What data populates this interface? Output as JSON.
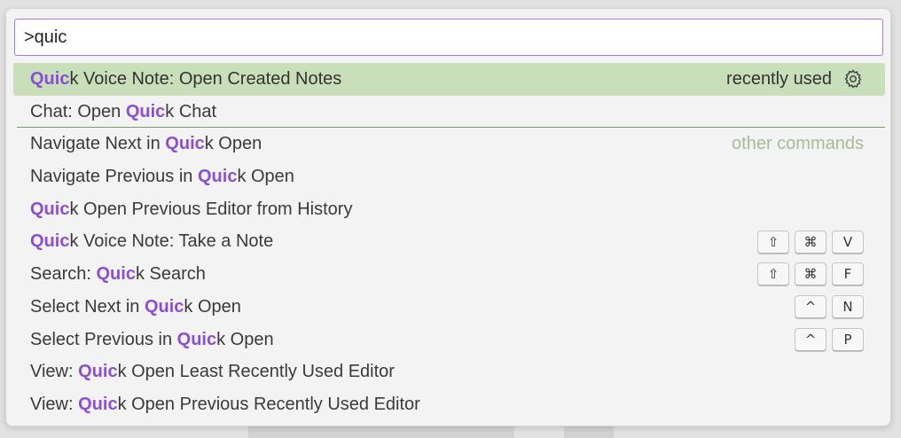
{
  "search": {
    "value": ">quic"
  },
  "items": [
    {
      "pre": "",
      "match": "Quic",
      "post": "k Voice Note: Open Created Notes",
      "group": "recently used",
      "keys": []
    },
    {
      "pre": "Chat: Open ",
      "match": "Quic",
      "post": "k Chat",
      "group": "",
      "keys": []
    },
    {
      "pre": "Navigate Next in ",
      "match": "Quic",
      "post": "k Open",
      "group": "other commands",
      "keys": []
    },
    {
      "pre": "Navigate Previous in ",
      "match": "Quic",
      "post": "k Open",
      "group": "",
      "keys": []
    },
    {
      "pre": "",
      "match": "Quic",
      "post": "k Open Previous Editor from History",
      "group": "",
      "keys": []
    },
    {
      "pre": "",
      "match": "Quic",
      "post": "k Voice Note: Take a Note",
      "group": "",
      "keys": [
        "⇧",
        "⌘",
        "V"
      ]
    },
    {
      "pre": "Search: ",
      "match": "Quic",
      "post": "k Search",
      "group": "",
      "keys": [
        "⇧",
        "⌘",
        "F"
      ]
    },
    {
      "pre": "Select Next in ",
      "match": "Quic",
      "post": "k Open",
      "group": "",
      "keys": [
        "^",
        "N"
      ]
    },
    {
      "pre": "Select Previous in ",
      "match": "Quic",
      "post": "k Open",
      "group": "",
      "keys": [
        "^",
        "P"
      ]
    },
    {
      "pre": "View: ",
      "match": "Quic",
      "post": "k Open Least Recently Used Editor",
      "group": "",
      "keys": []
    },
    {
      "pre": "View: ",
      "match": "Quic",
      "post": "k Open Previous Recently Used Editor",
      "group": "",
      "keys": []
    }
  ],
  "colors": {
    "selected_bg": "#c8dfb9",
    "highlight": "#8b4fd6",
    "focus_border": "#a97ad8"
  },
  "icons": {
    "configure": "gear-icon"
  }
}
